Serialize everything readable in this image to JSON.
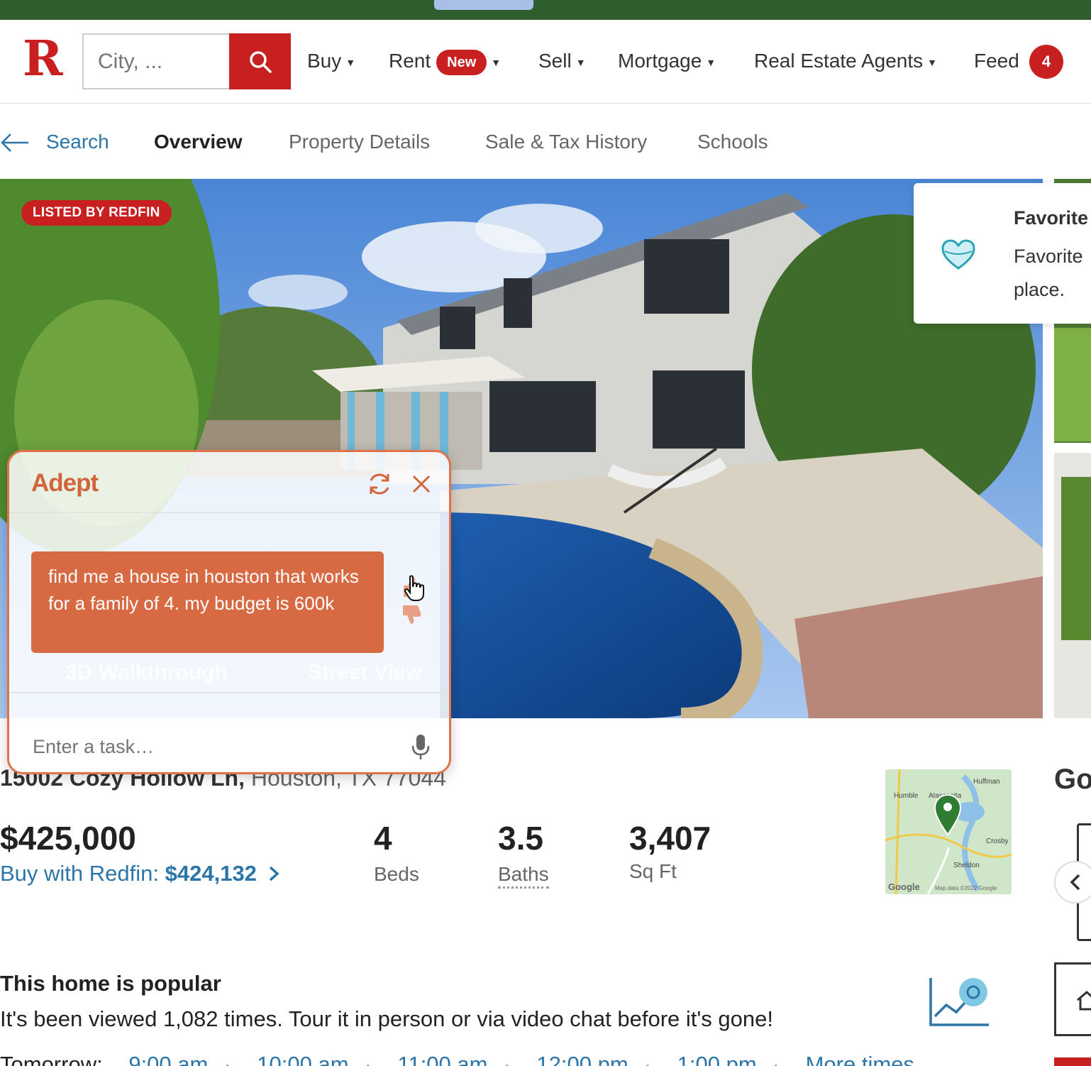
{
  "header": {
    "logo": "R",
    "search_placeholder": "City, ...",
    "nav": {
      "buy": "Buy",
      "rent": "Rent",
      "rent_badge": "New",
      "sell": "Sell",
      "mortgage": "Mortgage",
      "agents": "Real Estate Agents",
      "feed": "Feed",
      "feed_count": "4"
    }
  },
  "subnav": {
    "back": "Search",
    "tabs": [
      "Overview",
      "Property Details",
      "Sale & Tax History",
      "Schools"
    ]
  },
  "photo": {
    "badge": "LISTED BY REDFIN"
  },
  "favorite": {
    "title": "Favorite",
    "desc": "Favorite place."
  },
  "adept": {
    "title": "Adept",
    "message": "find me a house in houston that works for a family of 4. my budget is 600k",
    "ghost_walkthrough": "3D Walkthrough",
    "ghost_street": "Street View",
    "input_placeholder": "Enter a task…"
  },
  "listing": {
    "address_street": "15002 Cozy Hollow Ln,",
    "address_city": "Houston, TX 77044",
    "price": "$425,000",
    "buy_with_label": "Buy with Redfin:",
    "buy_with_price": "$424,132",
    "beds": "4",
    "beds_label": "Beds",
    "baths": "3.5",
    "baths_label": "Baths",
    "sqft": "3,407",
    "sqft_label": "Sq Ft"
  },
  "map": {
    "labels": [
      "Huffman",
      "Humble",
      "Atascocita",
      "Crosby",
      "Sheldon"
    ],
    "attribution": "Google",
    "map_data": "Map data ©2022 Google"
  },
  "side": {
    "go": "Go"
  },
  "popular": {
    "title": "This home is popular",
    "desc": "It's been viewed 1,082 times. Tour it in person or via video chat before it's gone!"
  },
  "tour": {
    "day": "Tomorrow:",
    "times": [
      "9:00 am",
      "10:00 am",
      "11:00 am",
      "12:00 pm",
      "1:00 pm",
      "More times"
    ]
  },
  "colors": {
    "brand_red": "#c82021",
    "adept_orange": "#d86a43",
    "link_blue": "#2c75a8"
  }
}
